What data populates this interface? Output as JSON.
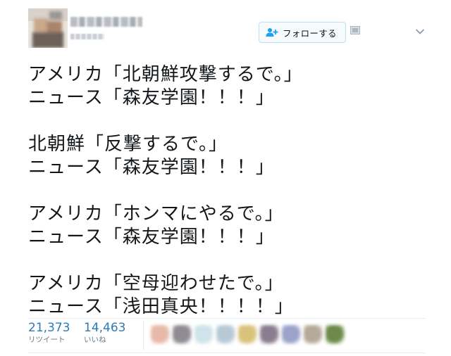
{
  "tweet": {
    "follow_button": {
      "label": "フォローする",
      "icon": "person-plus-icon"
    },
    "lines": [
      "アメリカ「北朝鮮攻撃するで。」",
      "ニュース「森友学園！！！」",
      "",
      "北朝鮮「反撃するで。」",
      "ニュース「森友学園！！！」",
      "",
      "アメリカ「ホンマにやるで。」",
      "ニュース「森友学園！！！」",
      "",
      "アメリカ「空母迎わせたで。」",
      "ニュース「浅田真央！！！！」"
    ]
  },
  "stats": {
    "retweets": {
      "count": "21,373",
      "label": "リツイート"
    },
    "likes": {
      "count": "14,463",
      "label": "いいね"
    }
  },
  "colors": {
    "accent": "#2b7bb9",
    "text": "#14171a",
    "muted": "#657786",
    "border": "#e6ecf0",
    "follow_border": "#bfe0f5"
  },
  "liker_avatars": [
    {
      "color": "#e6b9a8"
    },
    {
      "color": "#8f8a93"
    },
    {
      "color": "#cfe3ea"
    },
    {
      "color": "#b8c9d6"
    },
    {
      "color": "#d9c27a"
    },
    {
      "color": "#8a7d8f"
    },
    {
      "color": "#9aa3c9"
    },
    {
      "color": "#b5a99a"
    },
    {
      "color": "#6d8a4a"
    }
  ]
}
